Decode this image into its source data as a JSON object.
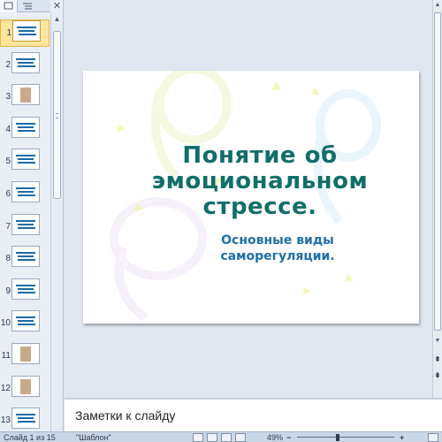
{
  "thumbnails": {
    "selected": "1",
    "items": [
      {
        "number": "1"
      },
      {
        "number": "2"
      },
      {
        "number": "3"
      },
      {
        "number": "4"
      },
      {
        "number": "5"
      },
      {
        "number": "6"
      },
      {
        "number": "7"
      },
      {
        "number": "8"
      },
      {
        "number": "9"
      },
      {
        "number": "10"
      },
      {
        "number": "11"
      },
      {
        "number": "12"
      },
      {
        "number": "13"
      }
    ]
  },
  "slide": {
    "title": "Понятие об\nэмоциональном\nстрессе.",
    "subtitle": "Основные виды\nсаморегуляции."
  },
  "notes": {
    "placeholder": "Заметки к слайду"
  },
  "status": {
    "slide_info": "Слайд 1 из 15",
    "theme": "\"Шаблон\"",
    "zoom": "49%"
  },
  "colors": {
    "title": "#116e6a",
    "subtitle": "#1f6fa8",
    "selected_thumb": "#fde59e"
  }
}
